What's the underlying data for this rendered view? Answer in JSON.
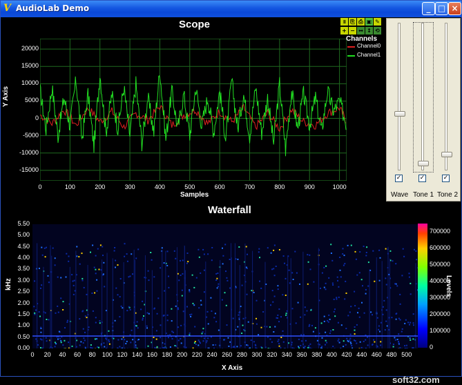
{
  "window": {
    "title": "AudioLab Demo"
  },
  "scope": {
    "title": "Scope",
    "xlabel": "Samples",
    "ylabel": "Y Axis",
    "y_ticks": [
      "20000",
      "15000",
      "10000",
      "5000",
      "0",
      "-5000",
      "-10000",
      "-15000"
    ],
    "x_ticks": [
      "0",
      "100",
      "200",
      "300",
      "400",
      "500",
      "600",
      "700",
      "800",
      "900",
      "1000"
    ],
    "legend_title": "Channels",
    "series": [
      {
        "name": "Channel0",
        "color": "#e02020"
      },
      {
        "name": "Channel1",
        "color": "#20e020"
      }
    ]
  },
  "waterfall": {
    "title": "Waterfall",
    "xlabel": "X Axis",
    "ylabel": "kHz",
    "colorbar_label": "Levels",
    "y_ticks": [
      "5.50",
      "5.00",
      "4.50",
      "4.00",
      "3.50",
      "3.00",
      "2.50",
      "2.00",
      "1.50",
      "1.00",
      "0.50",
      "0.00"
    ],
    "x_ticks": [
      "0",
      "20",
      "40",
      "60",
      "80",
      "100",
      "120",
      "140",
      "160",
      "180",
      "200",
      "220",
      "240",
      "260",
      "280",
      "300",
      "320",
      "340",
      "360",
      "380",
      "400",
      "420",
      "440",
      "460",
      "480",
      "500"
    ],
    "level_ticks": [
      "700000",
      "600000",
      "500000",
      "400000",
      "300000",
      "200000",
      "100000",
      "0"
    ]
  },
  "controls": {
    "sliders": [
      {
        "label": "Wave",
        "level": 0.38,
        "checked": true
      },
      {
        "label": "Tone 1",
        "level": 0.03,
        "checked": true
      },
      {
        "label": "Tone 2",
        "level": 0.09,
        "checked": true
      }
    ]
  },
  "watermark": "soft32.com",
  "chart_data": [
    {
      "type": "line",
      "title": "Scope",
      "xlabel": "Samples",
      "ylabel": "Y Axis",
      "xlim": [
        0,
        1024
      ],
      "ylim": [
        -18000,
        23000
      ],
      "grid": true,
      "legend": "top-right",
      "series": [
        {
          "name": "Channel0",
          "x": [
            0,
            40,
            80,
            120,
            160,
            200,
            240,
            280,
            320,
            360,
            400,
            440,
            480,
            520,
            560,
            600,
            640,
            680,
            720,
            760,
            800,
            840,
            880,
            920,
            960,
            1000,
            1024
          ],
          "values": [
            1000,
            -1500,
            2500,
            -2000,
            3000,
            -1000,
            2000,
            -2500,
            1500,
            -500,
            3500,
            -2000,
            1000,
            2500,
            -1500,
            2000,
            -1000,
            3000,
            -2500,
            1500,
            -3000,
            2500,
            -1000,
            -2000,
            1500,
            3000,
            -1000
          ]
        },
        {
          "name": "Channel1",
          "x": [
            0,
            20,
            40,
            60,
            80,
            100,
            120,
            140,
            160,
            180,
            200,
            220,
            240,
            260,
            280,
            300,
            320,
            340,
            360,
            380,
            400,
            420,
            440,
            460,
            480,
            500,
            520,
            540,
            560,
            580,
            600,
            620,
            640,
            660,
            680,
            700,
            720,
            740,
            760,
            780,
            800,
            820,
            840,
            860,
            880,
            900,
            920,
            940,
            960,
            980,
            1000,
            1024
          ],
          "values": [
            8000,
            -3000,
            9000,
            -5000,
            6000,
            -2000,
            11000,
            -6000,
            7000,
            -8000,
            13000,
            -4000,
            7000,
            -3000,
            9000,
            -5000,
            10000,
            -7000,
            6000,
            -4000,
            14000,
            -6000,
            8000,
            -3000,
            7000,
            -5000,
            9000,
            -2000,
            6000,
            -4000,
            8000,
            -6000,
            11000,
            -3000,
            7000,
            -5000,
            9000,
            -4000,
            6000,
            -7000,
            10000,
            -9000,
            8000,
            -3000,
            7000,
            -2000,
            6000,
            -4000,
            8000,
            2000,
            5000,
            -2000
          ]
        }
      ]
    },
    {
      "type": "heatmap",
      "title": "Waterfall",
      "xlabel": "X Axis",
      "ylabel": "kHz",
      "xlim": [
        0,
        515
      ],
      "ylim": [
        0,
        5.5
      ],
      "colorbar": {
        "label": "Levels",
        "range": [
          0,
          750000
        ]
      }
    }
  ]
}
